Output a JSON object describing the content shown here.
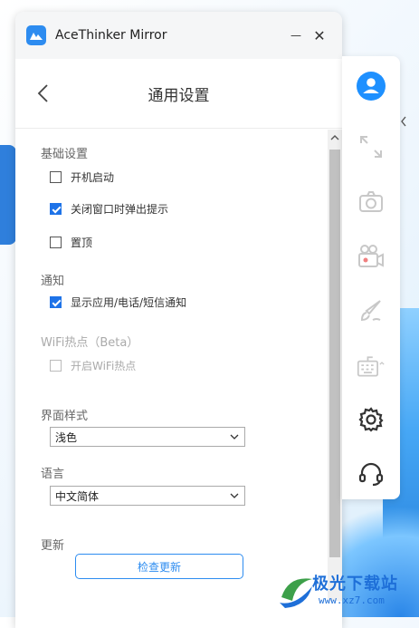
{
  "window": {
    "title": "AceThinker Mirror",
    "minimize_glyph": "—",
    "close_glyph": "✕"
  },
  "header": {
    "title": "通用设置"
  },
  "sections": {
    "basic": {
      "title": "基础设置",
      "items": [
        {
          "label": "开机启动",
          "checked": false
        },
        {
          "label": "关闭窗口时弹出提示",
          "checked": true
        },
        {
          "label": "置顶",
          "checked": false
        }
      ]
    },
    "notify": {
      "title": "通知",
      "items": [
        {
          "label": "显示应用/电话/短信通知",
          "checked": true
        }
      ]
    },
    "wifi": {
      "title": "WiFi热点（Beta）",
      "items": [
        {
          "label": "开启WiFi热点",
          "checked": false,
          "disabled": true
        }
      ]
    },
    "theme": {
      "title": "界面样式",
      "selected": "浅色"
    },
    "language": {
      "title": "语言",
      "selected": "中文简体"
    },
    "update": {
      "title": "更新",
      "button_label": "检查更新"
    }
  },
  "sidebar": {
    "items": [
      {
        "icon": "user-avatar-icon"
      },
      {
        "icon": "fullscreen-icon"
      },
      {
        "icon": "camera-icon"
      },
      {
        "icon": "video-record-icon"
      },
      {
        "icon": "brush-icon"
      },
      {
        "icon": "keyboard-icon"
      },
      {
        "icon": "settings-gear-icon"
      },
      {
        "icon": "headset-support-icon"
      }
    ]
  },
  "watermark": {
    "text": "极光下载站",
    "url": "www.xz7.com"
  },
  "colors": {
    "accent": "#2d8cf0",
    "checkbox": "#1e73e8",
    "sidebar_active": "#333333",
    "sidebar_inactive": "#cccccc"
  }
}
